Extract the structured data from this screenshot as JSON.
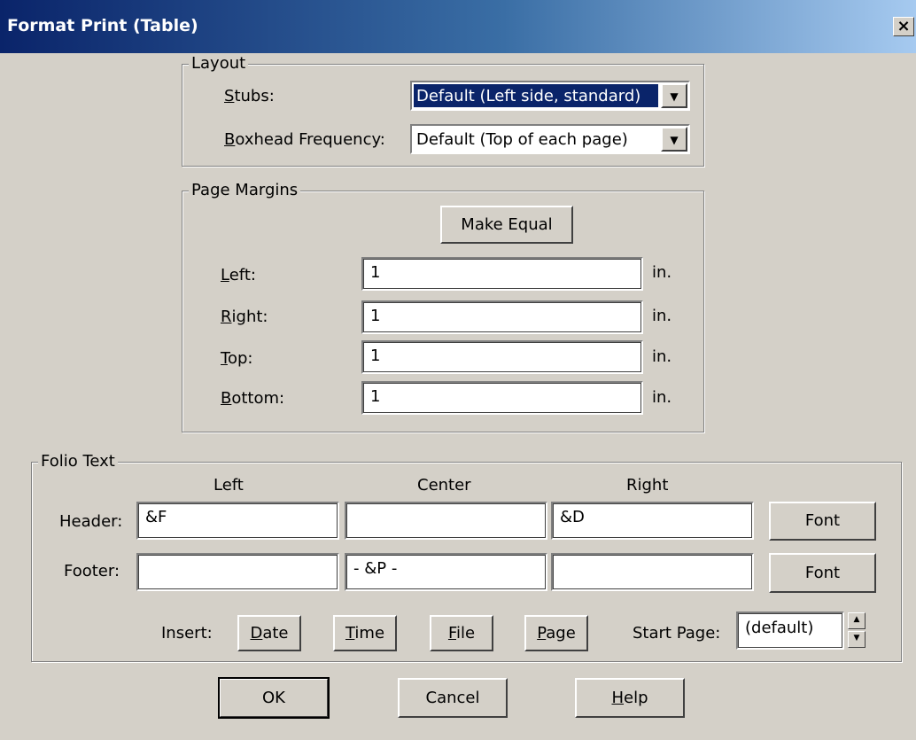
{
  "window": {
    "title": "Format Print (Table)",
    "close_glyph": "×"
  },
  "layout": {
    "legend": "Layout",
    "stubs_label_u": "S",
    "stubs_label_rest": "tubs:",
    "stubs_value": "Default (Left side, standard)",
    "boxhead_label_u": "B",
    "boxhead_label_rest": "oxhead Frequency:",
    "boxhead_value": "Default (Top of each page)"
  },
  "margins": {
    "legend": "Page Margins",
    "make_equal_label": "Make Equal",
    "unit": "in.",
    "rows": [
      {
        "label_u": "L",
        "label_rest": "eft:",
        "value": "1"
      },
      {
        "label_u": "R",
        "label_rest": "ight:",
        "value": "1"
      },
      {
        "label_u": "T",
        "label_rest": "op:",
        "value": "1"
      },
      {
        "label_u": "B",
        "label_rest": "ottom:",
        "value": "1"
      }
    ]
  },
  "folio": {
    "legend": "Folio Text",
    "col_left": "Left",
    "col_center": "Center",
    "col_right": "Right",
    "header_label": "Header:",
    "header": {
      "left": "&F",
      "center": "",
      "right": "&D"
    },
    "footer_label": "Footer:",
    "footer": {
      "left": "",
      "center": "- &P -",
      "right": ""
    },
    "font_label": "Font",
    "insert_label": "Insert:",
    "date_u": "D",
    "date_rest": "ate",
    "time_u": "T",
    "time_rest": "ime",
    "file_u": "F",
    "file_rest": "ile",
    "page_u": "P",
    "page_rest": "age",
    "start_page_label": "Start Page:",
    "start_page_value": "(default)"
  },
  "buttons": {
    "ok": "OK",
    "cancel": "Cancel",
    "help_u": "H",
    "help_rest": "elp"
  },
  "icons": {
    "dropdown": "▼",
    "spin_up": "▲",
    "spin_down": "▼"
  }
}
